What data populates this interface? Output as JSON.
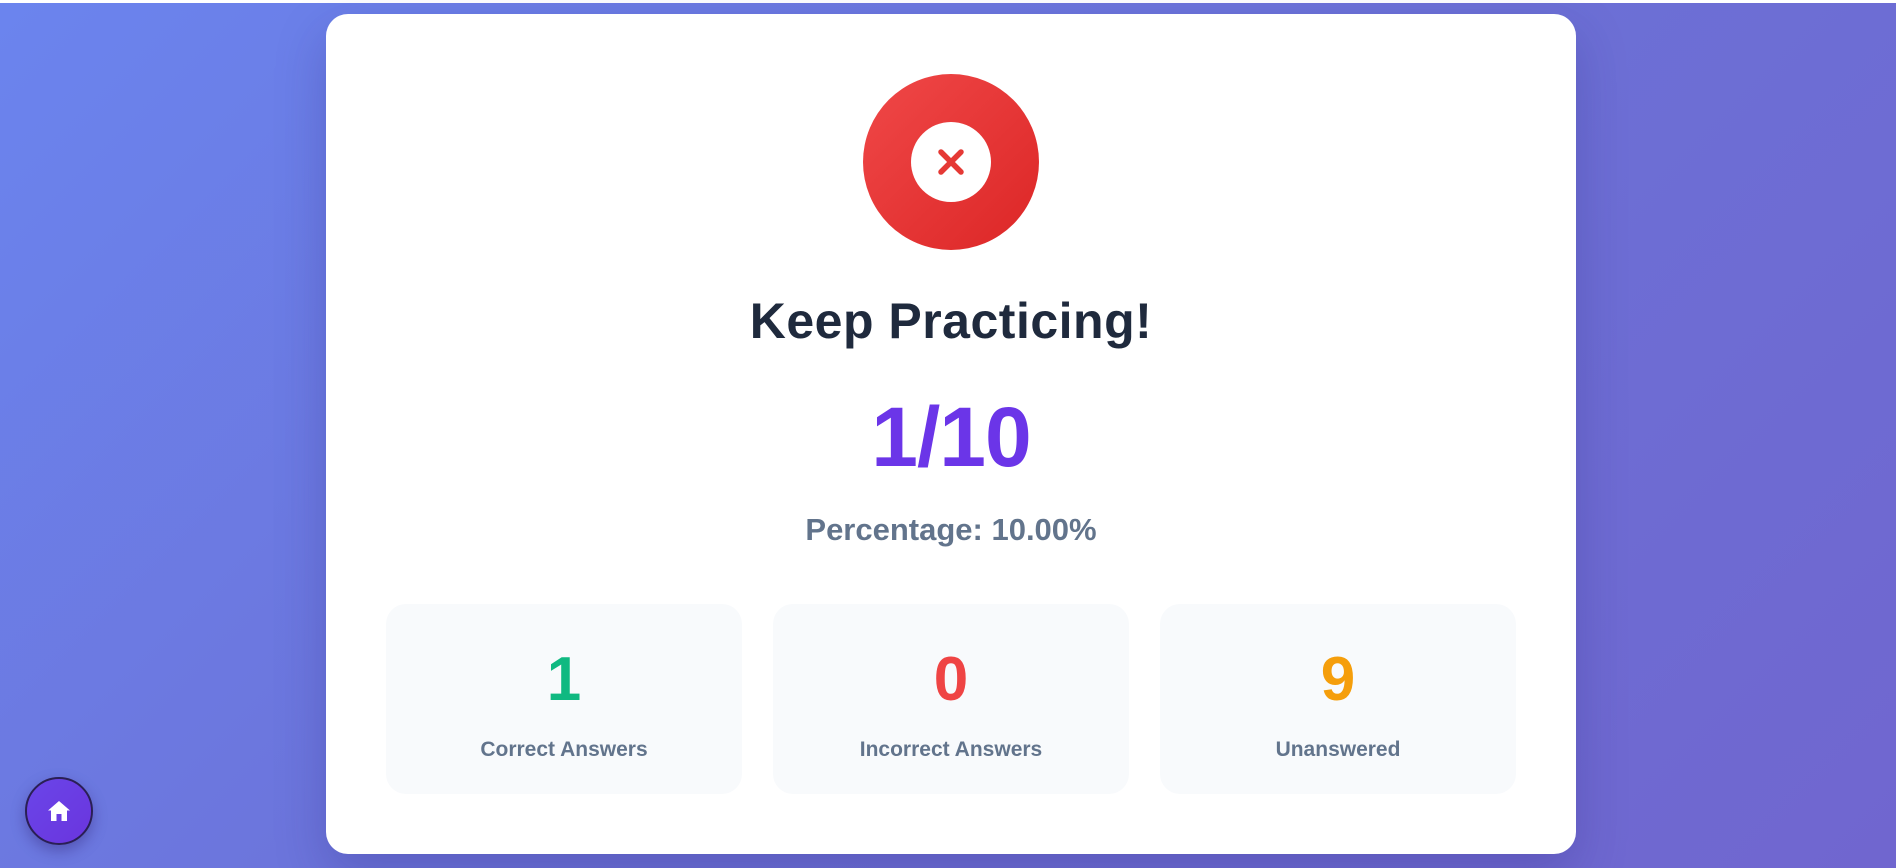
{
  "result": {
    "icon": "close-icon",
    "badge_color": "#e53e3e",
    "title": "Keep Practicing!",
    "score": "1/10",
    "percentage": "Percentage: 10.00%"
  },
  "stats": [
    {
      "value": "1",
      "label": "Correct Answers",
      "color": "#10b981"
    },
    {
      "value": "0",
      "label": "Incorrect Answers",
      "color": "#ef4444"
    },
    {
      "value": "9",
      "label": "Unanswered",
      "color": "#f59e0b"
    }
  ],
  "home_button": {
    "icon": "home-icon",
    "color": "#6b3ee8"
  }
}
